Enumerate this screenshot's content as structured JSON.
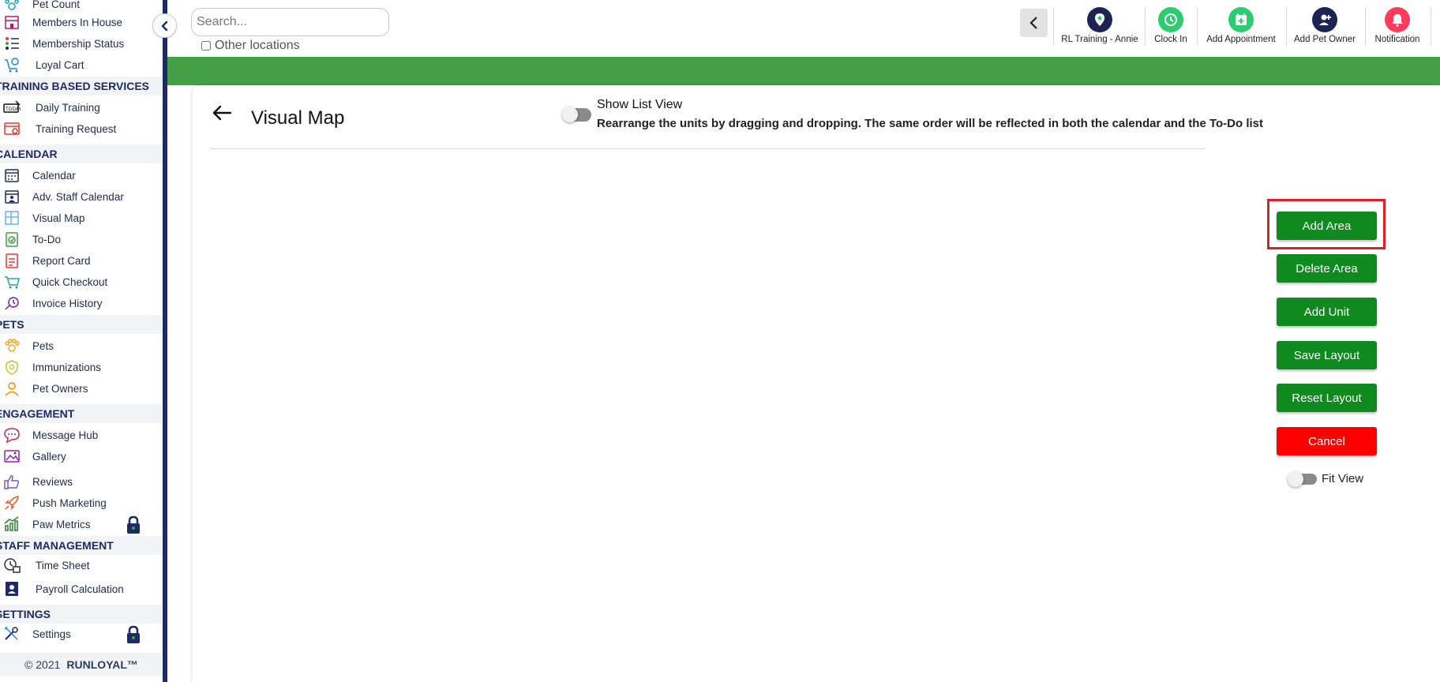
{
  "sidebar": {
    "items": [
      {
        "key": "pet-count",
        "label": "Pet Count"
      },
      {
        "key": "members-in-house",
        "label": "Members In House"
      },
      {
        "key": "membership-status",
        "label": "Membership Status"
      },
      {
        "key": "loyal-cart",
        "label": "Loyal Cart"
      },
      {
        "key": "daily-training",
        "label": "Daily Training"
      },
      {
        "key": "training-request",
        "label": "Training Request"
      },
      {
        "key": "calendar",
        "label": "Calendar"
      },
      {
        "key": "adv-staff-calendar",
        "label": "Adv. Staff Calendar"
      },
      {
        "key": "visual-map",
        "label": "Visual Map"
      },
      {
        "key": "to-do",
        "label": "To-Do"
      },
      {
        "key": "report-card",
        "label": "Report Card"
      },
      {
        "key": "quick-checkout",
        "label": "Quick Checkout"
      },
      {
        "key": "invoice-history",
        "label": "Invoice History"
      },
      {
        "key": "pets",
        "label": "Pets"
      },
      {
        "key": "immunizations",
        "label": "Immunizations"
      },
      {
        "key": "pet-owners",
        "label": "Pet Owners"
      },
      {
        "key": "message-hub",
        "label": "Message Hub"
      },
      {
        "key": "gallery",
        "label": "Gallery"
      },
      {
        "key": "reviews",
        "label": "Reviews"
      },
      {
        "key": "push-marketing",
        "label": "Push Marketing"
      },
      {
        "key": "paw-metrics",
        "label": "Paw Metrics"
      },
      {
        "key": "time-sheet",
        "label": "Time Sheet"
      },
      {
        "key": "payroll-calculation",
        "label": "Payroll Calculation"
      },
      {
        "key": "settings",
        "label": "Settings"
      }
    ],
    "sections": {
      "training": "TRAINING BASED SERVICES",
      "calendar": "CALENDAR",
      "pets": "PETS",
      "engagement": "ENGAGEMENT",
      "staff": "STAFF MANAGEMENT",
      "settings": "SETTINGS"
    },
    "copyright": "© 2021",
    "brand": "RUNLOYAL™"
  },
  "header": {
    "search_placeholder": "Search...",
    "other_locations_label": "Other locations",
    "actions": [
      {
        "label": "RL Training - Annie",
        "icon": "location-pin-icon",
        "color": "#1c2452"
      },
      {
        "label": "Clock In",
        "icon": "clock-icon",
        "color": "#2ecc71"
      },
      {
        "label": "Add Appointment",
        "icon": "calendar-add-icon",
        "color": "#2ecc71"
      },
      {
        "label": "Add Pet Owner",
        "icon": "add-user-icon",
        "color": "#1c2452"
      },
      {
        "label": "Notification",
        "icon": "bell-icon",
        "color": "#ff3b5c"
      }
    ]
  },
  "main": {
    "title": "Visual Map",
    "show_list_view_label": "Show List View",
    "list_hint": "Rearrange the units by dragging and dropping. The same order will be reflected in both the calendar and the To-Do list",
    "buttons": {
      "add_area": "Add Area",
      "delete_area": "Delete Area",
      "add_unit": "Add Unit",
      "save_layout": "Save Layout",
      "reset_layout": "Reset Layout",
      "cancel": "Cancel"
    },
    "fit_view_label": "Fit View"
  },
  "colors": {
    "header_band": "#43a047",
    "primary_button": "#0f8a1e",
    "cancel_button": "#ff0000",
    "highlight": "#e02020",
    "sidebar_accent": "#1e2a66"
  }
}
